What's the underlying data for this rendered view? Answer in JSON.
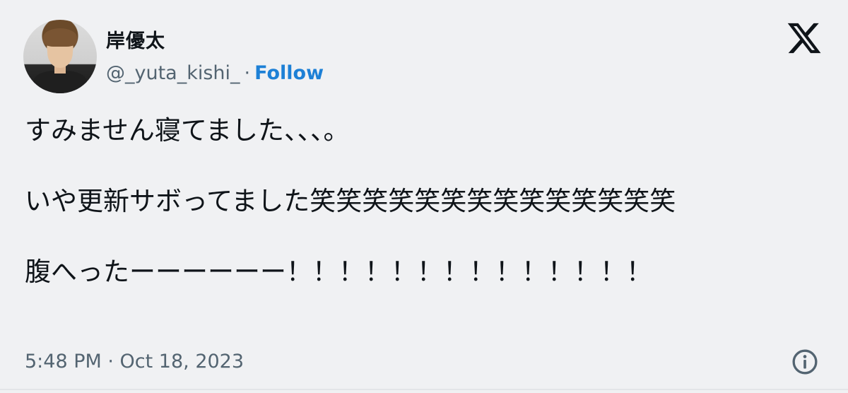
{
  "author": {
    "name": "岸優太",
    "handle": "@_yuta_kishi_",
    "separator": "·",
    "follow_label": "Follow"
  },
  "logo": {
    "icon": "x-logo-icon"
  },
  "tweet": {
    "line1": "すみません寝てました、、、。",
    "line2": "いや更新サボってました笑笑笑笑笑笑笑笑笑笑笑笑笑笑",
    "line3": "腹へったーーーーーー！！！！！！！！！！！！！！"
  },
  "footer": {
    "timestamp": "5:48 PM · Oct 18, 2023",
    "info_icon": "info-icon"
  },
  "colors": {
    "background": "#f0f1f3",
    "text": "#0f1419",
    "secondary": "#536471",
    "link": "#1d80d6"
  }
}
